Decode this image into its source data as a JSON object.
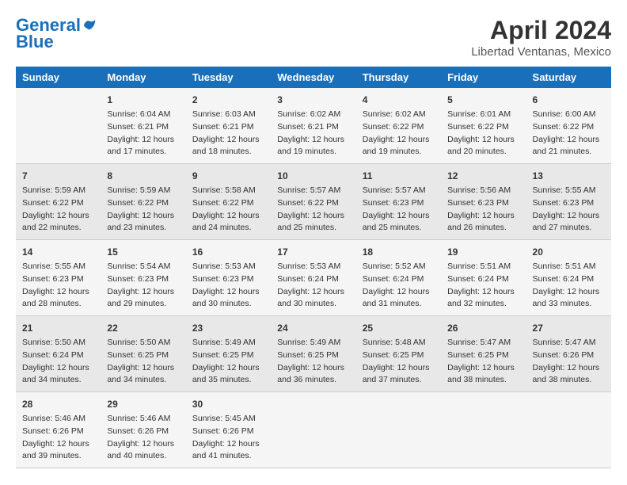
{
  "header": {
    "logo_line1": "General",
    "logo_line2": "Blue",
    "title": "April 2024",
    "subtitle": "Libertad Ventanas, Mexico"
  },
  "calendar": {
    "days_of_week": [
      "Sunday",
      "Monday",
      "Tuesday",
      "Wednesday",
      "Thursday",
      "Friday",
      "Saturday"
    ],
    "weeks": [
      [
        {
          "day": "",
          "sunrise": "",
          "sunset": "",
          "daylight": ""
        },
        {
          "day": "1",
          "sunrise": "Sunrise: 6:04 AM",
          "sunset": "Sunset: 6:21 PM",
          "daylight": "Daylight: 12 hours and 17 minutes."
        },
        {
          "day": "2",
          "sunrise": "Sunrise: 6:03 AM",
          "sunset": "Sunset: 6:21 PM",
          "daylight": "Daylight: 12 hours and 18 minutes."
        },
        {
          "day": "3",
          "sunrise": "Sunrise: 6:02 AM",
          "sunset": "Sunset: 6:21 PM",
          "daylight": "Daylight: 12 hours and 19 minutes."
        },
        {
          "day": "4",
          "sunrise": "Sunrise: 6:02 AM",
          "sunset": "Sunset: 6:22 PM",
          "daylight": "Daylight: 12 hours and 19 minutes."
        },
        {
          "day": "5",
          "sunrise": "Sunrise: 6:01 AM",
          "sunset": "Sunset: 6:22 PM",
          "daylight": "Daylight: 12 hours and 20 minutes."
        },
        {
          "day": "6",
          "sunrise": "Sunrise: 6:00 AM",
          "sunset": "Sunset: 6:22 PM",
          "daylight": "Daylight: 12 hours and 21 minutes."
        }
      ],
      [
        {
          "day": "7",
          "sunrise": "Sunrise: 5:59 AM",
          "sunset": "Sunset: 6:22 PM",
          "daylight": "Daylight: 12 hours and 22 minutes."
        },
        {
          "day": "8",
          "sunrise": "Sunrise: 5:59 AM",
          "sunset": "Sunset: 6:22 PM",
          "daylight": "Daylight: 12 hours and 23 minutes."
        },
        {
          "day": "9",
          "sunrise": "Sunrise: 5:58 AM",
          "sunset": "Sunset: 6:22 PM",
          "daylight": "Daylight: 12 hours and 24 minutes."
        },
        {
          "day": "10",
          "sunrise": "Sunrise: 5:57 AM",
          "sunset": "Sunset: 6:22 PM",
          "daylight": "Daylight: 12 hours and 25 minutes."
        },
        {
          "day": "11",
          "sunrise": "Sunrise: 5:57 AM",
          "sunset": "Sunset: 6:23 PM",
          "daylight": "Daylight: 12 hours and 25 minutes."
        },
        {
          "day": "12",
          "sunrise": "Sunrise: 5:56 AM",
          "sunset": "Sunset: 6:23 PM",
          "daylight": "Daylight: 12 hours and 26 minutes."
        },
        {
          "day": "13",
          "sunrise": "Sunrise: 5:55 AM",
          "sunset": "Sunset: 6:23 PM",
          "daylight": "Daylight: 12 hours and 27 minutes."
        }
      ],
      [
        {
          "day": "14",
          "sunrise": "Sunrise: 5:55 AM",
          "sunset": "Sunset: 6:23 PM",
          "daylight": "Daylight: 12 hours and 28 minutes."
        },
        {
          "day": "15",
          "sunrise": "Sunrise: 5:54 AM",
          "sunset": "Sunset: 6:23 PM",
          "daylight": "Daylight: 12 hours and 29 minutes."
        },
        {
          "day": "16",
          "sunrise": "Sunrise: 5:53 AM",
          "sunset": "Sunset: 6:23 PM",
          "daylight": "Daylight: 12 hours and 30 minutes."
        },
        {
          "day": "17",
          "sunrise": "Sunrise: 5:53 AM",
          "sunset": "Sunset: 6:24 PM",
          "daylight": "Daylight: 12 hours and 30 minutes."
        },
        {
          "day": "18",
          "sunrise": "Sunrise: 5:52 AM",
          "sunset": "Sunset: 6:24 PM",
          "daylight": "Daylight: 12 hours and 31 minutes."
        },
        {
          "day": "19",
          "sunrise": "Sunrise: 5:51 AM",
          "sunset": "Sunset: 6:24 PM",
          "daylight": "Daylight: 12 hours and 32 minutes."
        },
        {
          "day": "20",
          "sunrise": "Sunrise: 5:51 AM",
          "sunset": "Sunset: 6:24 PM",
          "daylight": "Daylight: 12 hours and 33 minutes."
        }
      ],
      [
        {
          "day": "21",
          "sunrise": "Sunrise: 5:50 AM",
          "sunset": "Sunset: 6:24 PM",
          "daylight": "Daylight: 12 hours and 34 minutes."
        },
        {
          "day": "22",
          "sunrise": "Sunrise: 5:50 AM",
          "sunset": "Sunset: 6:25 PM",
          "daylight": "Daylight: 12 hours and 34 minutes."
        },
        {
          "day": "23",
          "sunrise": "Sunrise: 5:49 AM",
          "sunset": "Sunset: 6:25 PM",
          "daylight": "Daylight: 12 hours and 35 minutes."
        },
        {
          "day": "24",
          "sunrise": "Sunrise: 5:49 AM",
          "sunset": "Sunset: 6:25 PM",
          "daylight": "Daylight: 12 hours and 36 minutes."
        },
        {
          "day": "25",
          "sunrise": "Sunrise: 5:48 AM",
          "sunset": "Sunset: 6:25 PM",
          "daylight": "Daylight: 12 hours and 37 minutes."
        },
        {
          "day": "26",
          "sunrise": "Sunrise: 5:47 AM",
          "sunset": "Sunset: 6:25 PM",
          "daylight": "Daylight: 12 hours and 38 minutes."
        },
        {
          "day": "27",
          "sunrise": "Sunrise: 5:47 AM",
          "sunset": "Sunset: 6:26 PM",
          "daylight": "Daylight: 12 hours and 38 minutes."
        }
      ],
      [
        {
          "day": "28",
          "sunrise": "Sunrise: 5:46 AM",
          "sunset": "Sunset: 6:26 PM",
          "daylight": "Daylight: 12 hours and 39 minutes."
        },
        {
          "day": "29",
          "sunrise": "Sunrise: 5:46 AM",
          "sunset": "Sunset: 6:26 PM",
          "daylight": "Daylight: 12 hours and 40 minutes."
        },
        {
          "day": "30",
          "sunrise": "Sunrise: 5:45 AM",
          "sunset": "Sunset: 6:26 PM",
          "daylight": "Daylight: 12 hours and 41 minutes."
        },
        {
          "day": "",
          "sunrise": "",
          "sunset": "",
          "daylight": ""
        },
        {
          "day": "",
          "sunrise": "",
          "sunset": "",
          "daylight": ""
        },
        {
          "day": "",
          "sunrise": "",
          "sunset": "",
          "daylight": ""
        },
        {
          "day": "",
          "sunrise": "",
          "sunset": "",
          "daylight": ""
        }
      ]
    ]
  }
}
